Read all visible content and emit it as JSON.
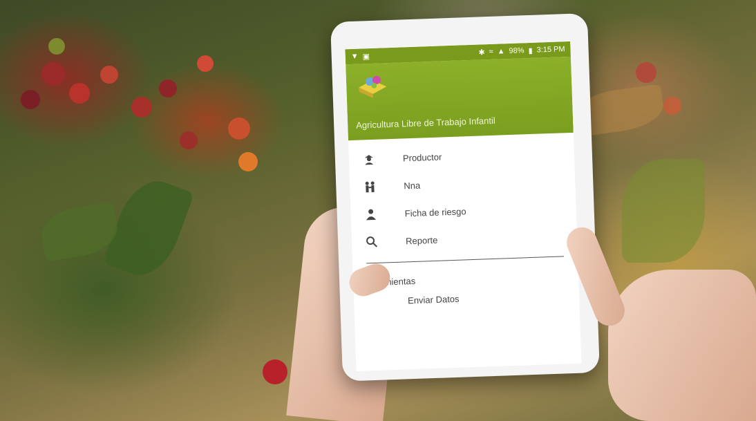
{
  "status_bar": {
    "battery": "98%",
    "time": "3:15 PM"
  },
  "app": {
    "title": "Agricultura Libre de Trabajo Infantil"
  },
  "menu": {
    "items": [
      {
        "label": "Productor",
        "icon": "farmer-icon"
      },
      {
        "label": "Nna",
        "icon": "children-icon"
      },
      {
        "label": "Ficha de riesgo",
        "icon": "person-icon"
      },
      {
        "label": "Reporte",
        "icon": "search-icon"
      }
    ],
    "section_title": "Herramientas",
    "tools": [
      {
        "label": "Enviar Datos",
        "icon": "send-icon"
      }
    ]
  },
  "colors": {
    "header": "#7a9e1e",
    "drawer_background": "#ffffff",
    "text": "#444444"
  }
}
